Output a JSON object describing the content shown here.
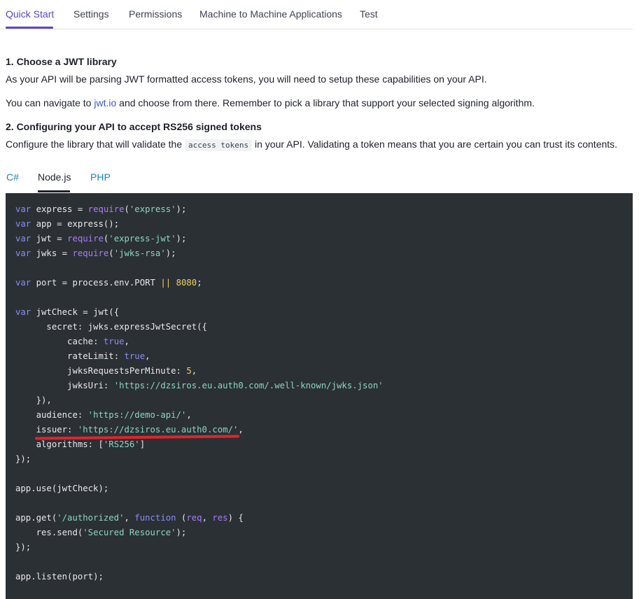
{
  "tabs": [
    {
      "label": "Quick Start",
      "active": true
    },
    {
      "label": "Settings",
      "active": false
    },
    {
      "label": "Permissions",
      "active": false
    },
    {
      "label": "Machine to Machine Applications",
      "active": false
    },
    {
      "label": "Test",
      "active": false
    }
  ],
  "step1": {
    "title": "1. Choose a JWT library",
    "para1": "As your API will be parsing JWT formatted access tokens, you will need to setup these capabilities on your API.",
    "para2_prefix": "You can navigate to ",
    "para2_link": "jwt.io",
    "para2_suffix": " and choose from there. Remember to pick a library that support your selected signing algorithm."
  },
  "step2": {
    "title": "2. Configuring your API to accept RS256 signed tokens",
    "para_prefix": "Configure the library that will validate the ",
    "para_code": "access tokens",
    "para_suffix": " in your API. Validating a token means that you are certain you can trust its contents."
  },
  "lang_tabs": [
    {
      "label": "C#",
      "active": false
    },
    {
      "label": "Node.js",
      "active": true
    },
    {
      "label": "PHP",
      "active": false
    }
  ],
  "code": {
    "v_var": "var",
    "express": "express",
    "app": "app",
    "jwt": "jwt",
    "jwks": "jwks",
    "require": "require",
    "s_express": "'express'",
    "s_express_jwt": "'express-jwt'",
    "s_jwks_rsa": "'jwks-rsa'",
    "port": "port",
    "process_env": "process.env.PORT",
    "or": "||",
    "port_num": "8080",
    "jwtCheck": "jwtCheck",
    "secret": "secret",
    "expressJwtSecret": "jwks.expressJwtSecret",
    "cache": "cache",
    "true": "true",
    "rateLimit": "rateLimit",
    "jwksRequestsPerMinute": "jwksRequestsPerMinute",
    "rpm": "5",
    "jwksUri": "jwksUri",
    "s_jwksUri": "'https://dzsiros.eu.auth0.com/.well-known/jwks.json'",
    "audience": "audience",
    "s_audience": "'https://demo-api/'",
    "issuer": "issuer",
    "s_issuer": "'https://dzsiros.eu.auth0.com/'",
    "algorithms": "algorithms",
    "s_rs256": "'RS256'",
    "app_use": "app.use",
    "app_get": "app.get",
    "s_authorized": "'/authorized'",
    "function": "function",
    "req": "req",
    "res": "res",
    "res_send": "res.send",
    "s_secured": "'Secured Resource'",
    "app_listen": "app.listen"
  }
}
